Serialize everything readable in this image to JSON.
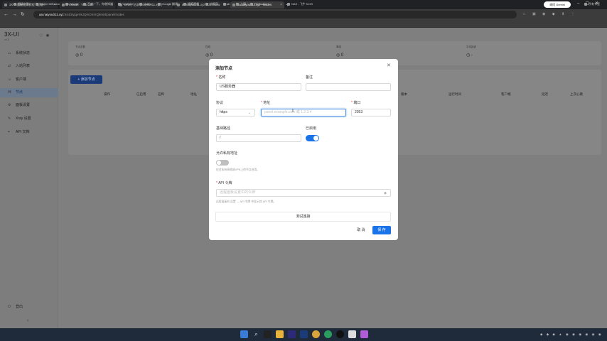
{
  "browser": {
    "tabs": [
      {
        "label": "3X-UI面板图文教程 · 超级..."
      },
      {
        "label": "Products - Vultr.com"
      },
      {
        "label": "DNS | 记录 | naiyou011.xyz |"
      },
      {
        "label": "aa.naiyou011.xyz - Overview"
      },
      {
        "label": "aa.naiyou011.xyz - Nodes"
      }
    ],
    "new_tab": "+",
    "gemini_label": "询问 Gemini",
    "url_host": "aa.naiyou011.xyz",
    "url_path": ":8443/yjqeXkJQmOmXQ8mM/panel/nodes",
    "bookmarks": [
      "超级大脑",
      "Stable Diffusion",
      "Google",
      "百度一下，你就知道",
      "YouTube",
      "Netflix",
      "Google 翻译",
      "搜狐视频",
      "护照页",
      "ai",
      "上网",
      "Flipboard - ...",
      "NAS - 飞牛 fnOS",
      "所有书签"
    ]
  },
  "app": {
    "brand": "3X-UI",
    "version": "v2.8",
    "nav": [
      {
        "label": "系统状态",
        "icon": "⚏"
      },
      {
        "label": "入站列表",
        "icon": "⇄"
      },
      {
        "label": "客户端",
        "icon": "☺"
      },
      {
        "label": "节点",
        "icon": "⌘"
      },
      {
        "label": "面板设置",
        "icon": "⚙"
      },
      {
        "label": "Xray 设置",
        "icon": "✎"
      },
      {
        "label": "API 文档",
        "icon": "⌖"
      }
    ],
    "logout": "登出",
    "stats": [
      {
        "label": "节点总数",
        "value": "0"
      },
      {
        "label": "在线",
        "value": "0"
      },
      {
        "label": "离线",
        "value": "0"
      },
      {
        "label": "平均延迟",
        "value": "-"
      }
    ],
    "add_button": "+ 添加节点",
    "table_headers": [
      "操作",
      "已启用",
      "名称",
      "地址",
      "版本",
      "运行时间",
      "客户端",
      "延迟",
      "上次心跳"
    ]
  },
  "modal": {
    "title": "添加节点",
    "name_label": "名称",
    "name_value": "US服务器",
    "remark_label": "备注",
    "protocol_label": "协议",
    "protocol_value": "https",
    "address_label": "地址",
    "address_placeholder": "panel.example.com 或 1.2.3.4",
    "port_label": "端口",
    "port_value": "2053",
    "base_path_label": "基础路径",
    "base_path_value": "/",
    "enabled_label": "已启用",
    "enabled": true,
    "allow_private_label": "允许私有地址",
    "allow_private": false,
    "allow_private_hint": "仅对私有网络或VPN上的节点启用。",
    "api_token_label": "API 令牌",
    "api_token_placeholder": "远程面板设置中的令牌",
    "api_token_hint": "远程面板的 设置 → API 令牌 中显示其 API 令牌。",
    "test_button": "测试连接",
    "cancel_button": "取 消",
    "save_button": "保 存"
  },
  "colors": {
    "accent": "#1a73e8",
    "overlay": "#7f7f7f"
  }
}
